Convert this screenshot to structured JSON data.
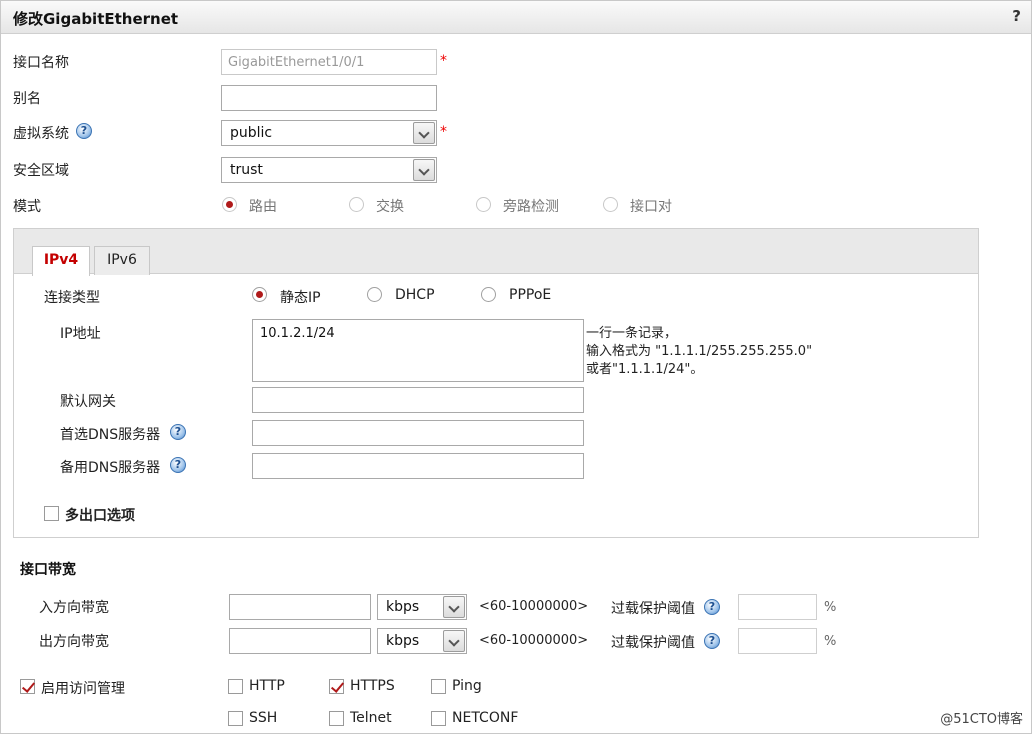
{
  "window": {
    "title": "修改GigabitEthernet",
    "help": "?"
  },
  "interface_name": {
    "label": "接口名称",
    "value": "GigabitEthernet1/0/1"
  },
  "alias": {
    "label": "别名",
    "value": ""
  },
  "vsys": {
    "label": "虚拟系统",
    "value": "public"
  },
  "zone": {
    "label": "安全区域",
    "value": "trust"
  },
  "mode": {
    "label": "模式",
    "options": [
      "路由",
      "交换",
      "旁路检测",
      "接口对"
    ],
    "selected": "路由"
  },
  "tabs": [
    "IPv4",
    "IPv6"
  ],
  "connection": {
    "label": "连接类型",
    "options": [
      "静态IP",
      "DHCP",
      "PPPoE"
    ],
    "selected": "静态IP"
  },
  "ip": {
    "label": "IP地址",
    "value": "10.1.2.1/24",
    "hint": [
      "一行一条记录，",
      "输入格式为 \"1.1.1.1/255.255.255.0\"",
      "或者\"1.1.1.1/24\"。"
    ]
  },
  "gateway": {
    "label": "默认网关",
    "value": ""
  },
  "dns_primary": {
    "label": "首选DNS服务器",
    "value": ""
  },
  "dns_backup": {
    "label": "备用DNS服务器",
    "value": ""
  },
  "multi_exit": {
    "label": "多出口选项",
    "checked": false
  },
  "bandwidth": {
    "title": "接口带宽",
    "inbound": {
      "label": "入方向带宽",
      "value": "",
      "unit": "kbps",
      "range": "<60-10000000>",
      "threshold_label": "过载保护阈值",
      "threshold": "",
      "percent": "%"
    },
    "outbound": {
      "label": "出方向带宽",
      "value": "",
      "unit": "kbps",
      "range": "<60-10000000>",
      "threshold_label": "过载保护阈值",
      "threshold": "",
      "percent": "%"
    }
  },
  "access": {
    "label": "启用访问管理",
    "checked": true,
    "services": [
      {
        "name": "HTTP",
        "checked": false
      },
      {
        "name": "HTTPS",
        "checked": true
      },
      {
        "name": "Ping",
        "checked": false
      },
      {
        "name": "SSH",
        "checked": false
      },
      {
        "name": "Telnet",
        "checked": false
      },
      {
        "name": "NETCONF",
        "checked": false
      }
    ]
  },
  "watermark": "@51CTO博客",
  "colors": {
    "accent": "#c40000",
    "help": "#3d7ec5"
  },
  "icons": {
    "help": "question-circle-icon",
    "dropdown": "chevron-down-icon"
  }
}
